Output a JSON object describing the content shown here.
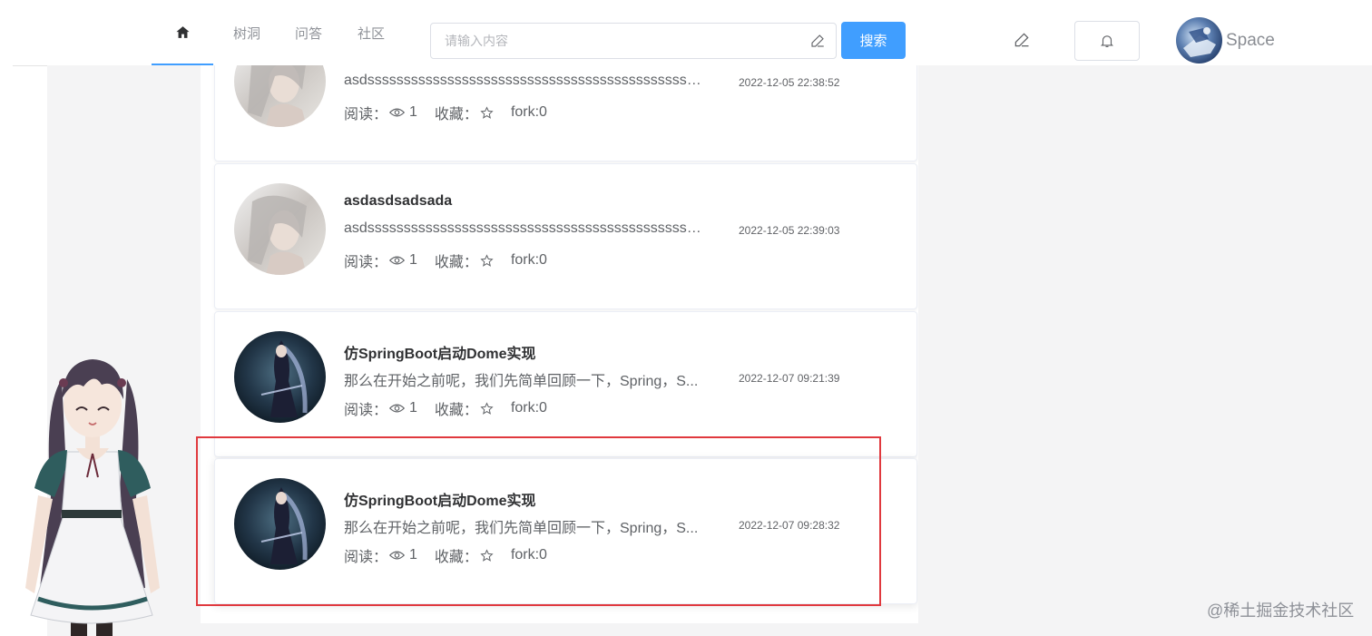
{
  "header": {
    "nav": [
      {
        "label": "树洞"
      },
      {
        "label": "问答"
      },
      {
        "label": "社区"
      }
    ],
    "search": {
      "placeholder": "请输入内容",
      "value": ""
    },
    "search_button": "搜索",
    "user": {
      "name": "Space"
    }
  },
  "feed": {
    "labels": {
      "read": "阅读：",
      "favorite": "收藏："
    },
    "posts": [
      {
        "title": "",
        "summary": "asdsssssssssssssssssssssssssssssssssssssssssssssssssss...",
        "time": "2022-12-05 22:38:52",
        "views": "1",
        "fork": "fork:0"
      },
      {
        "title": "asdasdsadsada",
        "summary": "asdsssssssssssssssssssssssssssssssssssssssssssssssssss...",
        "time": "2022-12-05 22:39:03",
        "views": "1",
        "fork": "fork:0"
      },
      {
        "title": "仿SpringBoot启动Dome实现",
        "summary": "那么在开始之前呢，我们先简单回顾一下，Spring，S...",
        "time": "2022-12-07 09:21:39",
        "views": "1",
        "fork": "fork:0"
      },
      {
        "title": "仿SpringBoot启动Dome实现",
        "summary": "那么在开始之前呢，我们先简单回顾一下，Spring，S...",
        "time": "2022-12-07 09:28:32",
        "views": "1",
        "fork": "fork:0"
      }
    ]
  },
  "watermark": "@稀土掘金技术社区",
  "colors": {
    "accent": "#409eff",
    "highlight": "#e0393e"
  }
}
